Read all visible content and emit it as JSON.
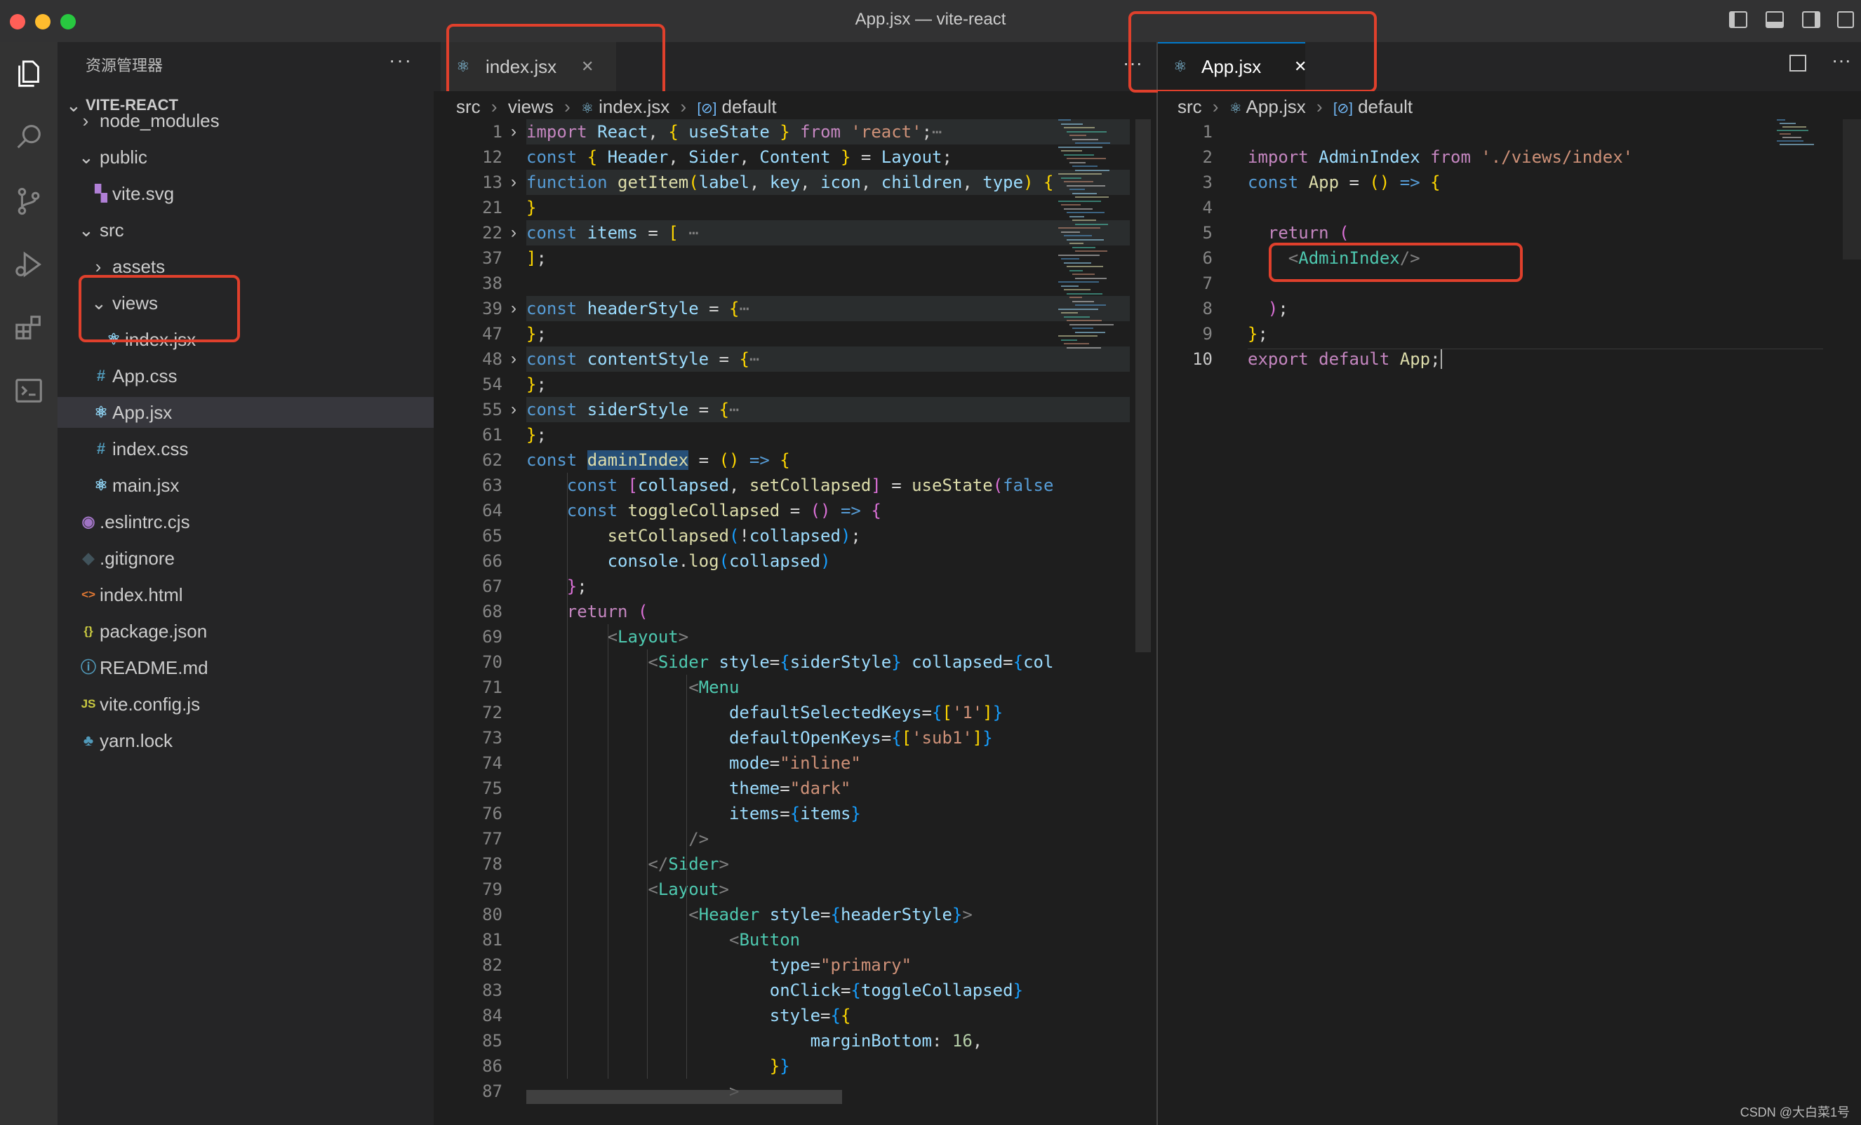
{
  "window": {
    "title": "App.jsx — vite-react"
  },
  "explorer": {
    "header": "资源管理器",
    "more": "···",
    "root": "VITE-REACT",
    "items": [
      {
        "name": "node_modules",
        "icon": "folder",
        "expanded": false
      },
      {
        "name": "public",
        "icon": "folder",
        "expanded": true
      },
      {
        "name": "vite.svg",
        "icon": "svg"
      },
      {
        "name": "src",
        "icon": "folder",
        "expanded": true
      },
      {
        "name": "assets",
        "icon": "folder",
        "expanded": false
      },
      {
        "name": "views",
        "icon": "folder",
        "expanded": true
      },
      {
        "name": "index.jsx",
        "icon": "react"
      },
      {
        "name": "App.css",
        "icon": "css"
      },
      {
        "name": "App.jsx",
        "icon": "react",
        "selected": true
      },
      {
        "name": "index.css",
        "icon": "css"
      },
      {
        "name": "main.jsx",
        "icon": "react"
      },
      {
        "name": ".eslintrc.cjs",
        "icon": "eslint"
      },
      {
        "name": ".gitignore",
        "icon": "git"
      },
      {
        "name": "index.html",
        "icon": "html"
      },
      {
        "name": "package.json",
        "icon": "json"
      },
      {
        "name": "README.md",
        "icon": "info"
      },
      {
        "name": "vite.config.js",
        "icon": "js"
      },
      {
        "name": "yarn.lock",
        "icon": "yarn"
      }
    ]
  },
  "left_editor": {
    "tab_label": "index.jsx",
    "tab_close": "✕",
    "more": "···",
    "breadcrumb": [
      "src",
      "views",
      "index.jsx",
      "default"
    ],
    "line_numbers": [
      "1",
      "12",
      "13",
      "21",
      "22",
      "37",
      "38",
      "39",
      "47",
      "48",
      "54",
      "55",
      "61",
      "62",
      "63",
      "64",
      "65",
      "66",
      "67",
      "68",
      "69",
      "70",
      "71",
      "72",
      "73",
      "74",
      "75",
      "76",
      "77",
      "78",
      "79",
      "80",
      "81",
      "82",
      "83",
      "84",
      "85",
      "86",
      "87"
    ]
  },
  "right_editor": {
    "tab_label": "App.jsx",
    "tab_close": "✕",
    "more": "···",
    "breadcrumb": [
      "src",
      "App.jsx",
      "default"
    ],
    "line_numbers": [
      "1",
      "2",
      "3",
      "4",
      "5",
      "6",
      "7",
      "8",
      "9",
      "10"
    ]
  },
  "watermark": "CSDN @大白菜1号",
  "colors": {
    "annotation": "#e0402c",
    "accent": "#007acc"
  }
}
